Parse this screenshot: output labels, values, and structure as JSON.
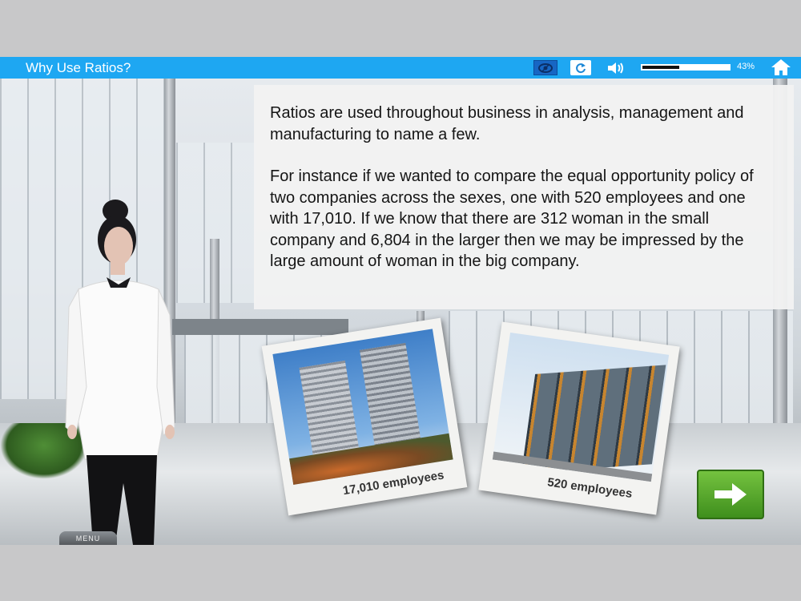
{
  "header": {
    "title": "Why Use Ratios?",
    "progress_percent": 43,
    "progress_label": "43%",
    "icons": [
      "eye-icon",
      "replay-icon",
      "speaker-icon",
      "home-icon"
    ]
  },
  "content": {
    "paragraph1": "Ratios are used throughout business in analysis, management and manufacturing to name a few.",
    "paragraph2": "For instance if we wanted to compare the equal opportunity policy of two companies across the sexes, one with 520 employees and one with 17,010.  If we know that there are 312 woman in the small company and 6,804 in the larger then we may be impressed by the large amount of woman in the big company."
  },
  "photos": {
    "large_caption": "17,010 employees",
    "small_caption": "520 employees"
  },
  "menu_label": "MENU",
  "colors": {
    "topbar": "#1ea7f2",
    "next_button": "#5aa92e",
    "background": "#c8c8c9"
  }
}
